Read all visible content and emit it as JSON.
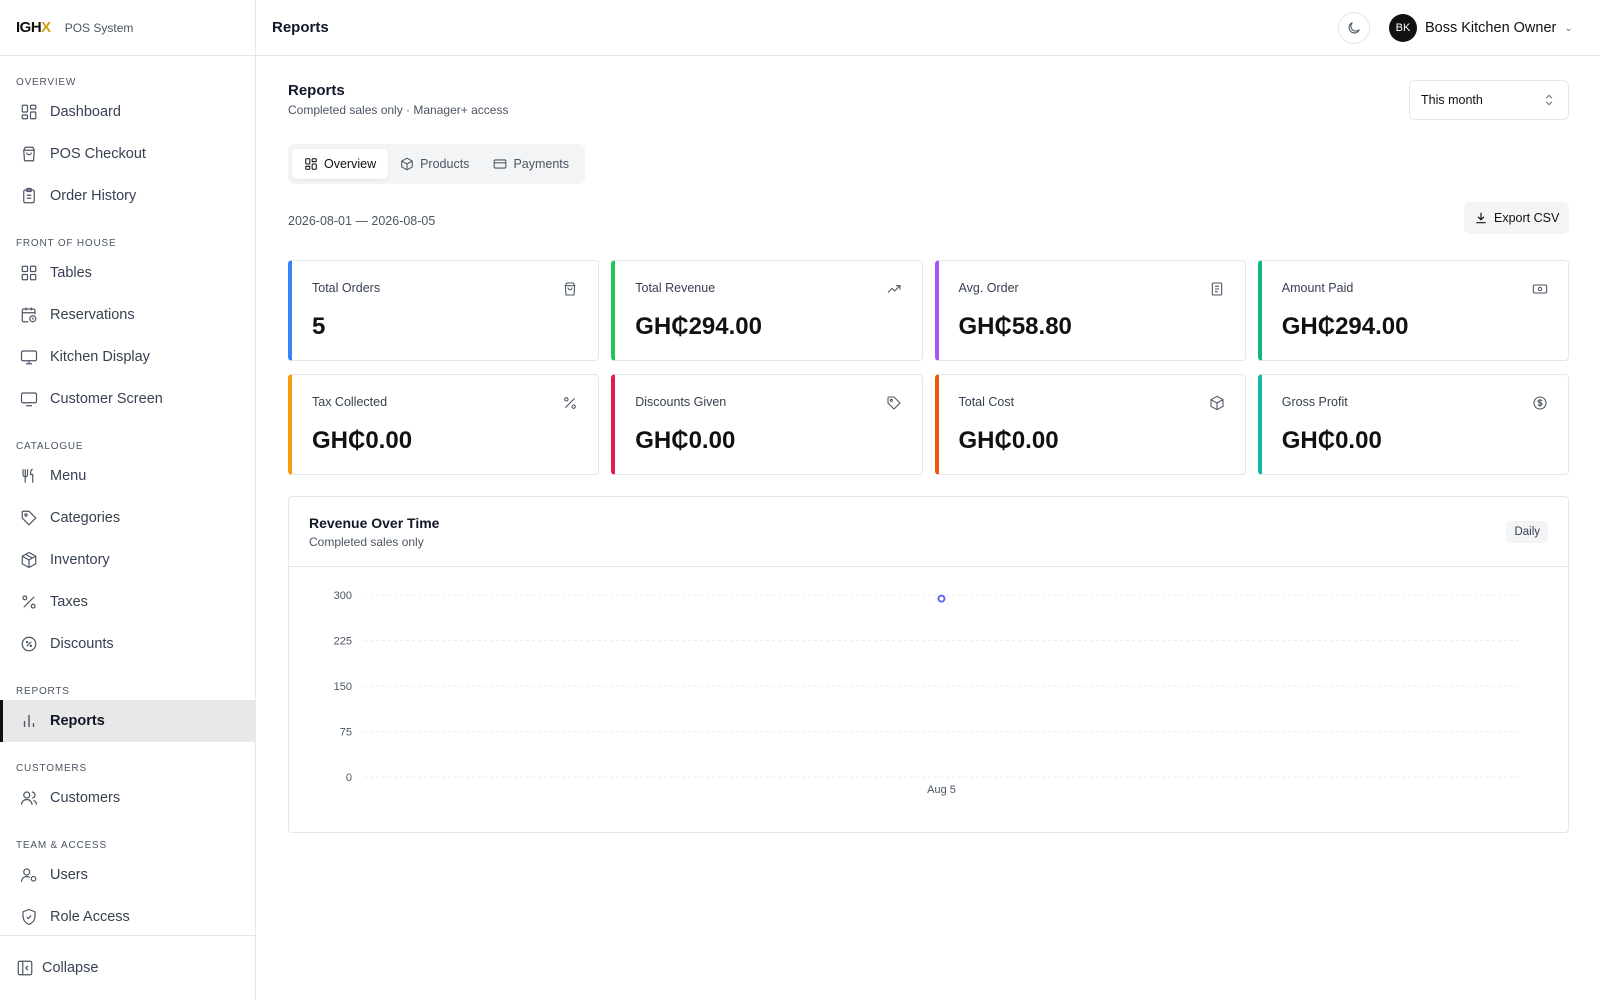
{
  "brand": {
    "logo_main": "IGH",
    "logo_accent": "X",
    "subtitle": "POS System"
  },
  "sidebar": {
    "sections": {
      "overview": "OVERVIEW",
      "front_of_house": "FRONT OF HOUSE",
      "catalogue": "CATALOGUE",
      "reports": "REPORTS",
      "customers": "CUSTOMERS",
      "team": "TEAM & ACCESS"
    },
    "items": {
      "dashboard": "Dashboard",
      "pos_checkout": "POS Checkout",
      "order_history": "Order History",
      "tables": "Tables",
      "reservations": "Reservations",
      "kitchen_display": "Kitchen Display",
      "customer_screen": "Customer Screen",
      "menu": "Menu",
      "categories": "Categories",
      "inventory": "Inventory",
      "taxes": "Taxes",
      "discounts": "Discounts",
      "reports": "Reports",
      "customers": "Customers",
      "users": "Users",
      "role_access": "Role Access"
    },
    "collapse": "Collapse"
  },
  "topbar": {
    "title": "Reports",
    "user_initials": "BK",
    "user_name": "Boss Kitchen Owner"
  },
  "page": {
    "title": "Reports",
    "subtitle": "Completed sales only · Manager+ access",
    "range_select": "This month",
    "tabs": [
      "Overview",
      "Products",
      "Payments"
    ],
    "date_range": "2026-08-01 — 2026-08-05",
    "export_label": "Export CSV"
  },
  "stats": [
    {
      "label": "Total Orders",
      "value": "5",
      "accent": "#3b82f6",
      "icon": "shopping-bag-icon"
    },
    {
      "label": "Total Revenue",
      "value": "GH₵294.00",
      "accent": "#22c55e",
      "icon": "trending-up-icon"
    },
    {
      "label": "Avg. Order",
      "value": "GH₵58.80",
      "accent": "#a855f7",
      "icon": "receipt-icon"
    },
    {
      "label": "Amount Paid",
      "value": "GH₵294.00",
      "accent": "#10b981",
      "icon": "banknote-icon"
    },
    {
      "label": "Tax Collected",
      "value": "GH₵0.00",
      "accent": "#f59e0b",
      "icon": "percent-icon"
    },
    {
      "label": "Discounts Given",
      "value": "GH₵0.00",
      "accent": "#e11d48",
      "icon": "tag-icon"
    },
    {
      "label": "Total Cost",
      "value": "GH₵0.00",
      "accent": "#ea580c",
      "icon": "package-icon"
    },
    {
      "label": "Gross Profit",
      "value": "GH₵0.00",
      "accent": "#14b8a6",
      "icon": "dollar-circle-icon"
    }
  ],
  "chart": {
    "title": "Revenue Over Time",
    "subtitle": "Completed sales only",
    "badge": "Daily"
  },
  "chart_data": {
    "type": "line",
    "categories": [
      "Aug 5"
    ],
    "series": [
      {
        "values": [
          294
        ]
      }
    ],
    "ylim": [
      0,
      300
    ],
    "yticks": [
      0,
      75,
      150,
      225,
      300
    ],
    "grid": true,
    "color": "#6366f1"
  }
}
